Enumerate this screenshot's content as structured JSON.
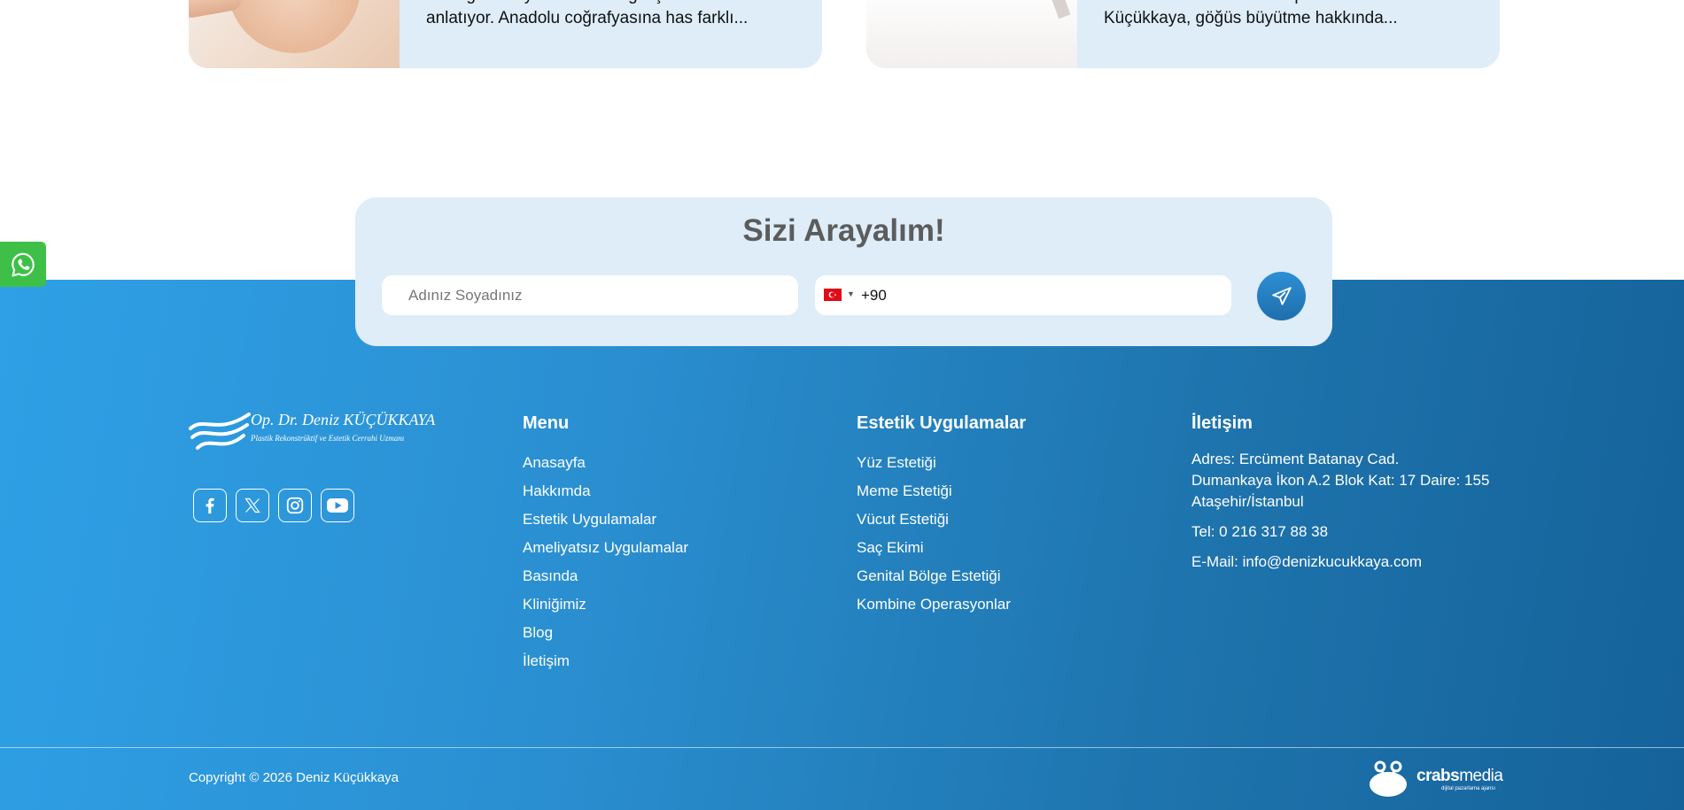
{
  "cards": [
    {
      "line1": "estetiği ameliyatındaki son gelişmeleri",
      "line2": "anlatıyor. Anadolu coğrafyasına has farklı..."
    },
    {
      "line1": "Estetik Cerrahi Uzmanı Op.Dr. Deniz",
      "line2": "Küçükkaya, göğüs büyütme hakkında..."
    }
  ],
  "callback": {
    "title": "Sizi Arayalım!",
    "name_placeholder": "Adınız Soyadınız",
    "phone_prefix": "+90"
  },
  "logo": {
    "name": "Op. Dr. Deniz KÜÇÜKKAYA",
    "subtitle": "Plastik Rekonstrüktif ve Estetik Cerrahi Uzmanı"
  },
  "menu": {
    "title": "Menu",
    "items": [
      "Anasayfa",
      "Hakkımda",
      "Estetik Uygulamalar",
      "Ameliyatsız Uygulamalar",
      "Basında",
      "Kliniğimiz",
      "Blog",
      "İletişim"
    ]
  },
  "aesthetic": {
    "title": "Estetik Uygulamalar",
    "items": [
      "Yüz Estetiği",
      "Meme Estetiği",
      "Vücut Estetiği",
      "Saç Ekimi",
      "Genital Bölge Estetiği",
      "Kombine Operasyonlar"
    ]
  },
  "contact": {
    "title": "İletişim",
    "address_1": "Adres: Ercüment Batanay Cad.",
    "address_2": "Dumankaya İkon A.2 Blok Kat: 17 Daire: 155",
    "address_3": "Ataşehir/İstanbul",
    "phone": "Tel: 0 216 317 88 38",
    "email": "E-Mail: info@denizkucukkaya.com"
  },
  "copyright": "Copyright © 2026 Deniz Küçükkaya",
  "agency": {
    "name_bold": "crabs",
    "name_light": "media",
    "tagline": "dijital pazarlama ajansı"
  },
  "icons": {
    "whatsapp": "whatsapp-icon",
    "send": "paper-plane-icon",
    "facebook": "facebook-icon",
    "x": "x-twitter-icon",
    "instagram": "instagram-icon",
    "youtube": "youtube-icon"
  },
  "colors": {
    "accent": "#2a8fd1",
    "whatsapp": "#3ec048",
    "form_bg": "#deedf8"
  }
}
